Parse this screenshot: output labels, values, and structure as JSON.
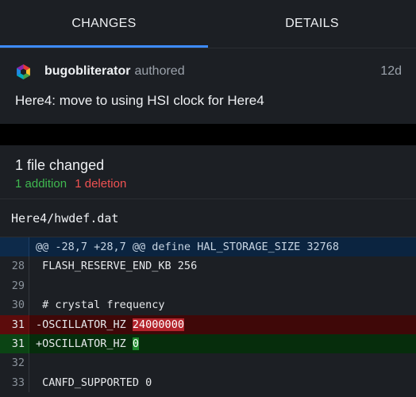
{
  "tabs": [
    {
      "label": "CHANGES",
      "active": true
    },
    {
      "label": "DETAILS",
      "active": false
    }
  ],
  "commit": {
    "author": "bugobliterator",
    "action": "authored",
    "age": "12d",
    "message": "Here4: move to using HSI clock for Here4",
    "avatar_icon": "hexagon-avatar-icon"
  },
  "summary": {
    "files_changed": "1 file changed",
    "additions": "1 addition",
    "deletions": "1 deletion"
  },
  "file": {
    "path": "Here4/hwdef.dat"
  },
  "diff": {
    "hunk_header": "@@ -28,7 +28,7 @@ define HAL_STORAGE_SIZE 32768",
    "lines": [
      {
        "num": "28",
        "type": "ctx",
        "text": " FLASH_RESERVE_END_KB 256"
      },
      {
        "num": "29",
        "type": "ctx",
        "text": ""
      },
      {
        "num": "30",
        "type": "ctx",
        "text": " # crystal frequency"
      },
      {
        "num": "31",
        "type": "del",
        "prefix": "-OSCILLATOR_HZ ",
        "highlight": "24000000"
      },
      {
        "num": "31",
        "type": "add",
        "prefix": "+OSCILLATOR_HZ ",
        "highlight": "0"
      },
      {
        "num": "32",
        "type": "ctx",
        "text": ""
      },
      {
        "num": "33",
        "type": "ctx",
        "text": " CANFD_SUPPORTED 0"
      }
    ]
  },
  "colors": {
    "background": "#1c1f24",
    "accent": "#3d8bff",
    "addition": "#3fb950",
    "deletion": "#f05252"
  }
}
